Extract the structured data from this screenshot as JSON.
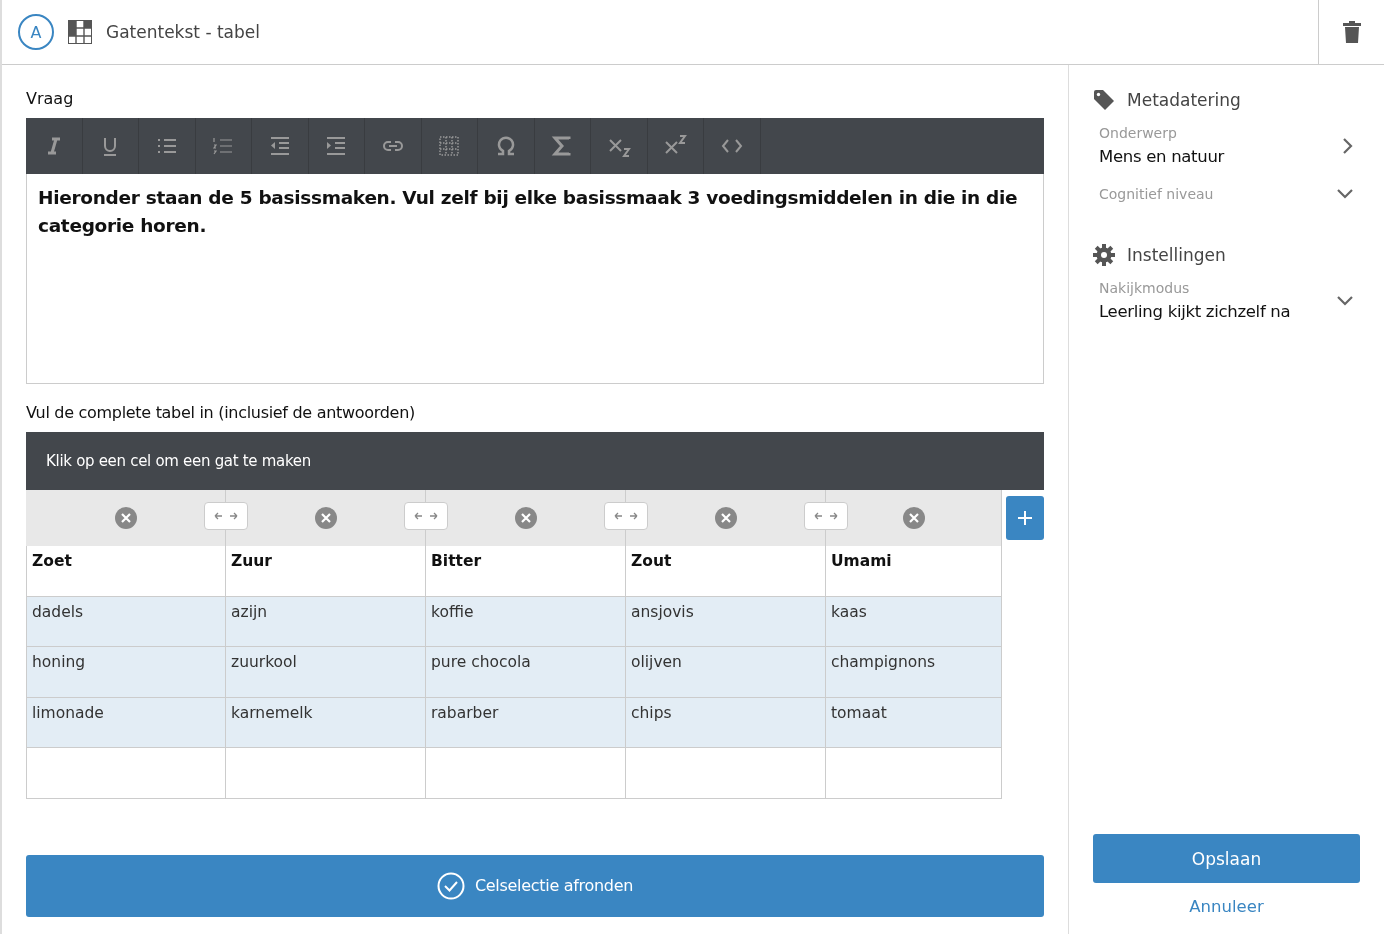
{
  "header": {
    "avatar": "A",
    "title": "Gatentekst - tabel"
  },
  "question": {
    "label": "Vraag",
    "toolbar": [
      {
        "kind": "italic"
      },
      {
        "kind": "underline"
      },
      {
        "kind": "bullets"
      },
      {
        "kind": "numbering"
      },
      {
        "kind": "outdent"
      },
      {
        "kind": "indent"
      },
      {
        "kind": "link"
      },
      {
        "kind": "table"
      },
      {
        "kind": "omega"
      },
      {
        "kind": "sigma"
      },
      {
        "kind": "subscript"
      },
      {
        "kind": "superscript"
      },
      {
        "kind": "code"
      }
    ],
    "text": "Hieronder staan de 5 basissmaken. Vul zelf bij elke basissmaak 3 voedingsmiddelen in die in die categorie horen."
  },
  "table_section": {
    "label": "Vul de complete tabel in (inclusief de antwoorden)",
    "hint": "Klik op een cel om een gat te maken",
    "rows": [
      [
        {
          "text": "Zoet",
          "header": true,
          "selected": false
        },
        {
          "text": "Zuur",
          "header": true,
          "selected": false
        },
        {
          "text": "Bitter",
          "header": true,
          "selected": false
        },
        {
          "text": "Zout",
          "header": true,
          "selected": false
        },
        {
          "text": "Umami",
          "header": true,
          "selected": false
        }
      ],
      [
        {
          "text": "dadels",
          "selected": true
        },
        {
          "text": "azijn",
          "selected": true
        },
        {
          "text": "koffie",
          "selected": true
        },
        {
          "text": "ansjovis",
          "selected": true
        },
        {
          "text": "kaas",
          "selected": true
        }
      ],
      [
        {
          "text": "honing",
          "selected": true
        },
        {
          "text": "zuurkool",
          "selected": true
        },
        {
          "text": "pure chocola",
          "selected": true
        },
        {
          "text": "olijven",
          "selected": true
        },
        {
          "text": "champignons",
          "selected": true
        }
      ],
      [
        {
          "text": "limonade",
          "selected": true
        },
        {
          "text": "karnemelk",
          "selected": true
        },
        {
          "text": "rabarber",
          "selected": true
        },
        {
          "text": "chips",
          "selected": true
        },
        {
          "text": "tomaat",
          "selected": true
        }
      ],
      [
        {
          "selected": false
        },
        {
          "selected": false
        },
        {
          "selected": false
        },
        {
          "selected": false
        },
        {
          "selected": false
        }
      ]
    ],
    "finish_button": "Celselectie afronden"
  },
  "sidebar": {
    "sections": [
      {
        "title": "Metadatering",
        "fields": [
          {
            "label": "Onderwerp",
            "value": "Mens en natuur",
            "kind": "link"
          },
          {
            "label": "Cognitief niveau",
            "kind": "dropdown"
          }
        ]
      },
      {
        "title": "Instellingen",
        "fields": [
          {
            "label": "Nakijkmodus",
            "value": "Leerling kijkt zichzelf na",
            "kind": "dropdown"
          }
        ]
      }
    ],
    "save_button": "Opslaan",
    "cancel_link": "Annuleer"
  }
}
